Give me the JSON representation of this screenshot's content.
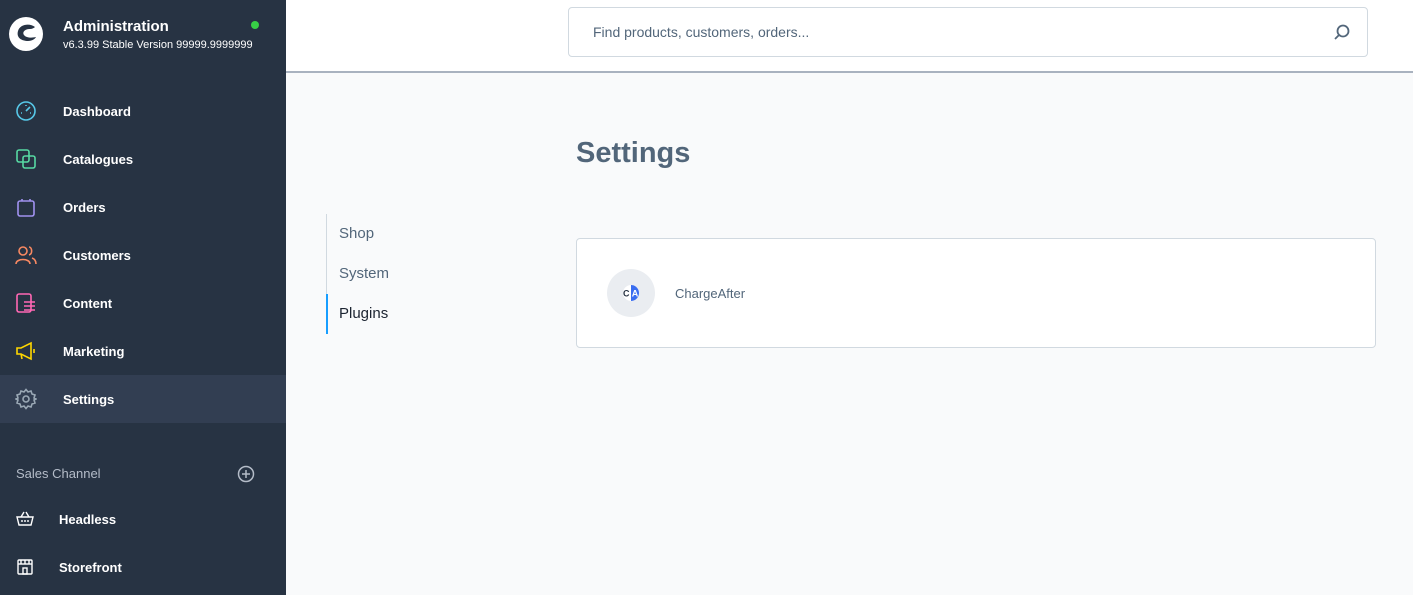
{
  "app": {
    "title": "Administration",
    "version": "v6.3.99 Stable Version 99999.9999999",
    "status_color": "#37d046"
  },
  "sidebar": {
    "items": [
      {
        "label": "Dashboard",
        "icon": "gauge-icon",
        "color": "#57d9a3"
      },
      {
        "label": "Catalogues",
        "icon": "catalogue-icon",
        "color": "#57d9a3"
      },
      {
        "label": "Orders",
        "icon": "shopping-bag-icon",
        "color": "#a092f0"
      },
      {
        "label": "Customers",
        "icon": "users-icon",
        "color": "#f88962"
      },
      {
        "label": "Content",
        "icon": "content-icon",
        "color": "#ff68b4"
      },
      {
        "label": "Marketing",
        "icon": "megaphone-icon",
        "color": "#ffd700"
      },
      {
        "label": "Settings",
        "icon": "gear-icon",
        "color": "#9aa8b5"
      }
    ],
    "active": "Settings",
    "sales_channel": {
      "header": "Sales Channel",
      "add_icon": "plus-circle-icon",
      "items": [
        {
          "label": "Headless",
          "icon": "basket-icon"
        },
        {
          "label": "Storefront",
          "icon": "storefront-icon"
        }
      ]
    }
  },
  "search": {
    "placeholder": "Find products, customers, orders..."
  },
  "page": {
    "title": "Settings",
    "tabs": [
      "Shop",
      "System",
      "Plugins"
    ],
    "active_tab": "Plugins"
  },
  "plugins": [
    {
      "label": "ChargeAfter",
      "logo_text": "CA"
    }
  ],
  "colors": {
    "sidebar_bg": "#273343",
    "accent": "#189eff",
    "text": "#52667a"
  }
}
